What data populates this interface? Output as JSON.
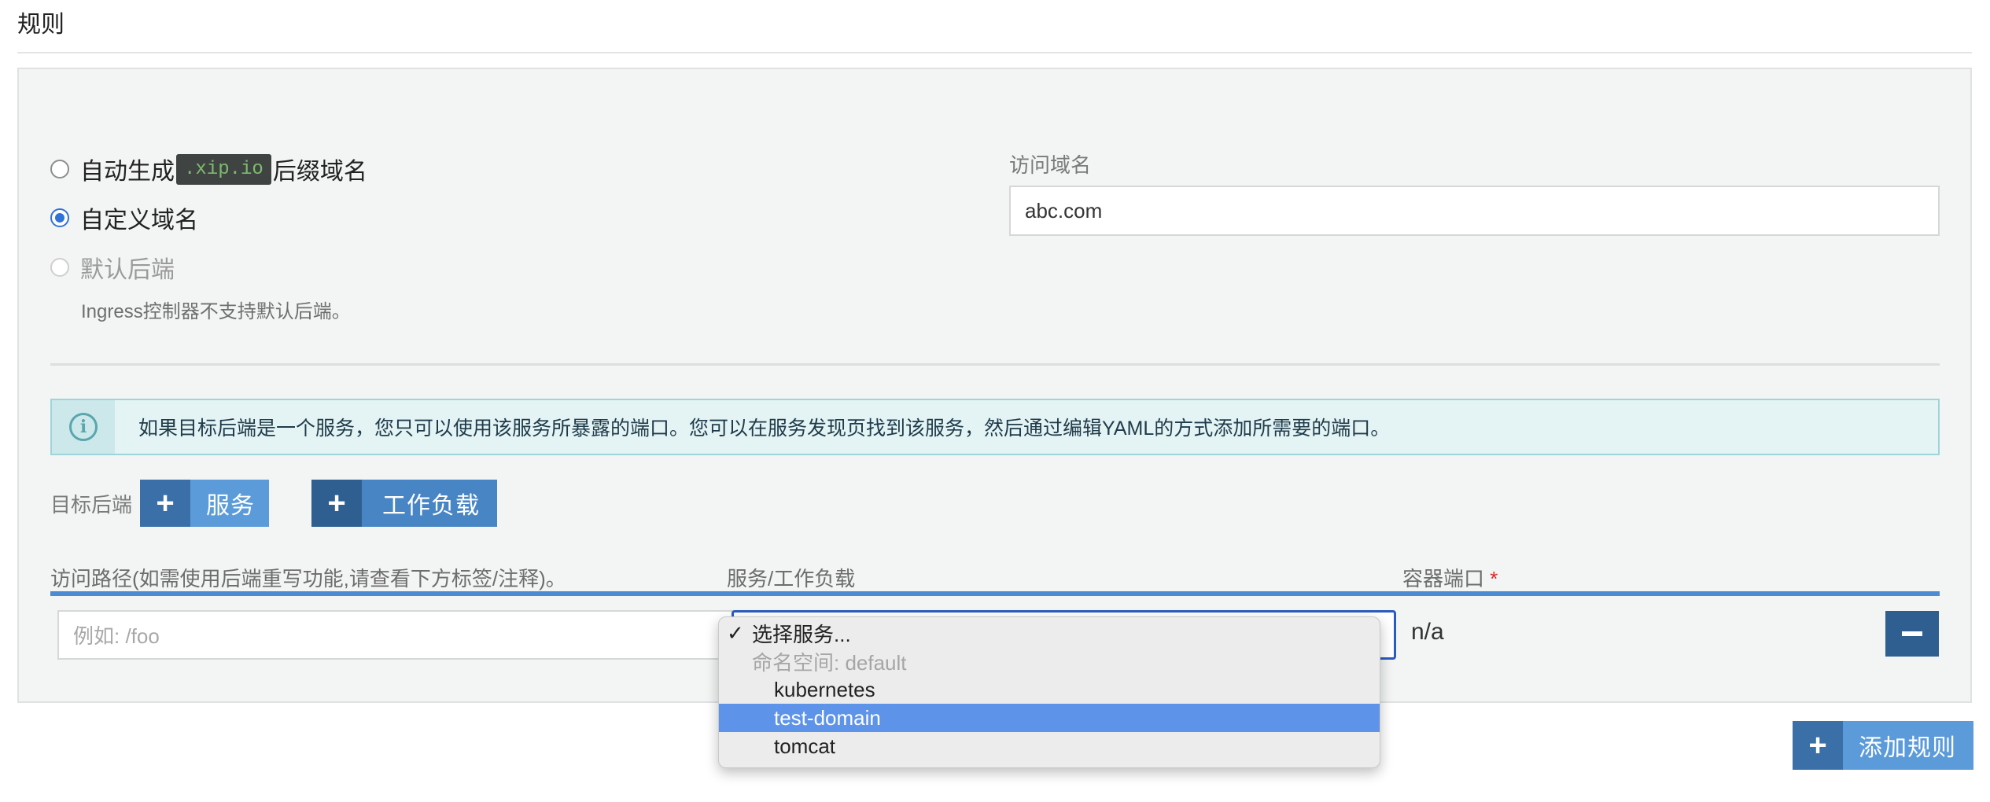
{
  "section": {
    "title": "规则"
  },
  "hostname": {
    "auto_prefix": "自动生成",
    "auto_code": ".xip.io",
    "auto_suffix": "后缀域名",
    "custom_label": "自定义域名",
    "default_backend_label": "默认后端",
    "default_backend_help": "Ingress控制器不支持默认后端。",
    "selected": "custom"
  },
  "domain_field": {
    "label": "访问域名",
    "value": "abc.com"
  },
  "info": {
    "text": "如果目标后端是一个服务，您只可以使用该服务所暴露的端口。您可以在服务发现页找到该服务，然后通过编辑YAML的方式添加所需要的端口。"
  },
  "target": {
    "label": "目标后端",
    "service_button": "服务",
    "workload_button": "工作负载",
    "plus": "+"
  },
  "table": {
    "columns": [
      "访问路径(如需使用后端重写功能,请查看下方标签/注释)。",
      "服务/工作负载",
      "容器端口"
    ],
    "required_mark": "*",
    "path_placeholder": "例如: /foo",
    "port_value": "n/a"
  },
  "dropdown": {
    "checkmark": "✓",
    "placeholder": "选择服务...",
    "group": "命名空间: default",
    "options": [
      "kubernetes",
      "test-domain",
      "tomcat"
    ],
    "highlighted": "test-domain"
  },
  "add_rule_button": "添加规则",
  "colors": {
    "primary": "#4785c4",
    "primary_dark": "#2f5f91",
    "highlight": "#5d93e9",
    "info_bg": "#e4f3f4"
  }
}
